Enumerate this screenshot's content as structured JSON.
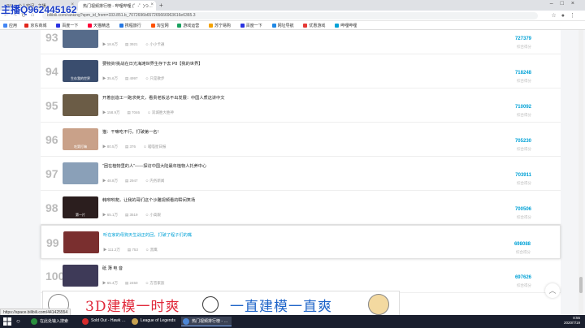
{
  "browser": {
    "tabs": [
      {
        "label": "Bilibili 个人空间 - 主播…",
        "active": false
      },
      {
        "label": "热门视频排行榜 - 哔哩哔哩 (゜-゜)つ…",
        "active": true
      }
    ],
    "address": "bilibili.com/ranking?spm_id_from=333.851.b_7072696b657265666963616e6365.3",
    "bookmarks": [
      {
        "label": "应用",
        "color": "#4285f4"
      },
      {
        "label": "京东商城",
        "color": "#e1251b"
      },
      {
        "label": "百度一下",
        "color": "#2932e1"
      },
      {
        "label": "天猫精选",
        "color": "#ff0036"
      },
      {
        "label": "携程旅行",
        "color": "#2577e3"
      },
      {
        "label": "淘宝网",
        "color": "#ff5000"
      },
      {
        "label": "游戏运营",
        "color": "#19a15f"
      },
      {
        "label": "苏宁易购",
        "color": "#f5a200"
      },
      {
        "label": "百度一下",
        "color": "#2932e1"
      },
      {
        "label": "网址导航",
        "color": "#1e88e5"
      },
      {
        "label": "优惠游戏",
        "color": "#e53935"
      },
      {
        "label": "哔哩哔哩",
        "color": "#00a1d6"
      }
    ]
  },
  "overlay": {
    "streamer": "主播Q962445162"
  },
  "ranking": [
    {
      "rank": "93",
      "title": "",
      "plays": "18.6万",
      "danmaku": "3921",
      "author": "小小卡通",
      "score": "727379",
      "score_label": "综合得分",
      "thumb": "#566b8a",
      "caption": ""
    },
    {
      "rank": "94",
      "title": "要物资!挑战在日光海滩世界生存下去 P8【我的世界】",
      "plays": "35.6万",
      "danmaku": "4997",
      "author": "只是散步",
      "score": "718248",
      "score_label": "综合得分",
      "thumb": "#3a4d6e",
      "caption": "生存我的世界"
    },
    {
      "rank": "95",
      "title": "开着创造工一跑求英文，看贵老板总不出发展：中国人质这讲中文",
      "plays": "158.9万",
      "danmaku": "7046",
      "author": "双城胜大胜神",
      "score": "710092",
      "score_label": "综合得分",
      "thumb": "#6b5c46",
      "caption": ""
    },
    {
      "rank": "96",
      "title": "猫：干嘛吃不行，打破第一名!",
      "plays": "80.5万",
      "danmaku": "376",
      "author": "喵喵星日报",
      "score": "705230",
      "score_label": "综合得分",
      "thumb": "#c9a189",
      "caption": "吃第打嘛"
    },
    {
      "rank": "97",
      "title": "\"困在植物里的人\"——探访中国大陆最年植物人托养中心",
      "plays": "48.8万",
      "danmaku": "2947",
      "author": "内务新闻",
      "score": "703911",
      "score_label": "综合得分",
      "thumb": "#8aa0b8",
      "caption": ""
    },
    {
      "rank": "98",
      "title": "韩咻咻爬，让我的哥们这个沙雕视频看的瞬间笑场",
      "plays": "65.1万",
      "danmaku": "3519",
      "author": "小高跟",
      "score": "700506",
      "score_label": "综合得分",
      "thumb": "#2b1e1e",
      "caption": "第一片"
    },
    {
      "rank": "99",
      "title": "听在家的母狗天生战正的回，打破了程子们的嘴",
      "plays": "111.2万",
      "danmaku": "753",
      "author": "黑鹰",
      "score": "698088",
      "score_label": "综合得分",
      "thumb": "#7a2f2f",
      "caption": ""
    },
    {
      "rank": "100",
      "title": "砥 薄 电 音",
      "plays": "65.4万",
      "danmaku": "2450",
      "author": "方音家族",
      "score": "697626",
      "score_label": "综合得分",
      "thumb": "#3e3a58",
      "caption": ""
    }
  ],
  "banner": {
    "left_text": "3D建模一时爽",
    "right_text": "一直建模一直爽"
  },
  "status_url": "https://space.bilibili.com/441425554",
  "taskbar": {
    "apps": [
      {
        "label": "在此处输入搜索",
        "color": "#2a8f3e",
        "active": false
      },
      {
        "label": "Sold Out - Hawk …",
        "color": "#d62b2b",
        "active": false
      },
      {
        "label": "League of Legends",
        "color": "#c7a250",
        "active": false
      },
      {
        "label": "热门视频排行榜 - …",
        "color": "#4b86d6",
        "active": true
      }
    ],
    "time": "8:55",
    "date": "2020/7/19"
  }
}
